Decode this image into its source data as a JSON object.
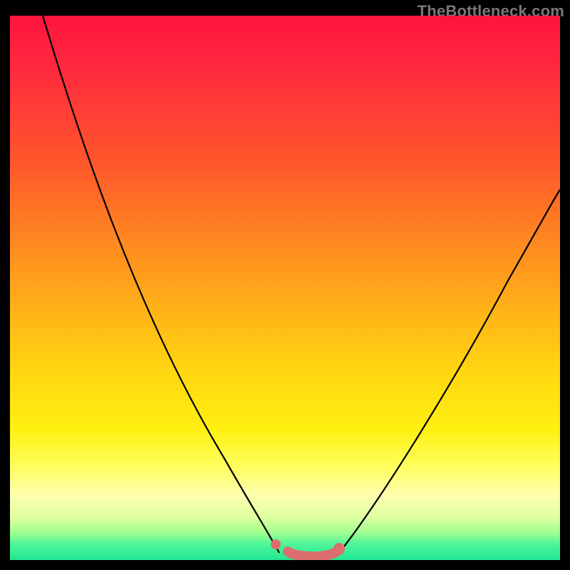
{
  "watermark": "TheBottleneck.com",
  "chart_data": {
    "type": "line",
    "title": "",
    "xlabel": "",
    "ylabel": "",
    "xlim": [
      0,
      100
    ],
    "ylim": [
      0,
      100
    ],
    "series": [
      {
        "name": "left-curve",
        "x": [
          6,
          12,
          18,
          24,
          30,
          36,
          42,
          46,
          49
        ],
        "y": [
          100,
          80,
          62,
          46,
          32,
          20,
          10,
          4,
          0
        ]
      },
      {
        "name": "right-curve",
        "x": [
          60,
          66,
          72,
          78,
          84,
          90,
          96,
          100
        ],
        "y": [
          0,
          6,
          14,
          24,
          36,
          48,
          60,
          68
        ]
      },
      {
        "name": "bottom-band",
        "x": [
          49,
          51,
          54,
          57,
          60
        ],
        "y": [
          0,
          0,
          0,
          0,
          0
        ]
      }
    ],
    "annotations": [
      {
        "name": "dot-left",
        "x": 49,
        "y": 1
      },
      {
        "name": "dot-right",
        "x": 60,
        "y": 1
      }
    ],
    "colors": {
      "curve": "#000000",
      "band": "#dd6e6e",
      "gradient_top": "#ff143e",
      "gradient_bottom": "#20e894"
    }
  }
}
